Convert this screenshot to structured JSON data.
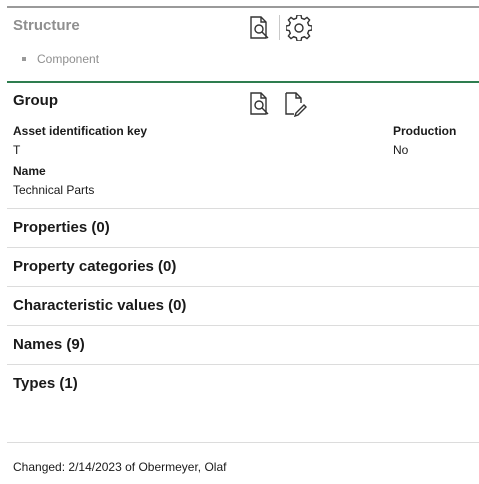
{
  "structure": {
    "title": "Structure",
    "items": [
      {
        "label": "Component"
      }
    ]
  },
  "group": {
    "title": "Group",
    "fields": {
      "asset_key_label": "Asset identification key",
      "asset_key_value": "T",
      "production_label": "Production",
      "production_value": "No",
      "name_label": "Name",
      "name_value": "Technical Parts"
    }
  },
  "sections": [
    {
      "label": "Properties (0)"
    },
    {
      "label": "Property categories (0)"
    },
    {
      "label": "Characteristic values (0)"
    },
    {
      "label": "Names (9)"
    },
    {
      "label": "Types (1)"
    }
  ],
  "footer": {
    "changed_label": "Changed:",
    "changed_value": "2/14/2023 of Obermeyer, Olaf"
  },
  "icons": {
    "structure_search": "document-search-icon",
    "structure_settings": "gear-icon",
    "group_search": "document-search-icon",
    "group_edit": "document-edit-icon"
  },
  "colors": {
    "accent_green": "#2e7d4f",
    "muted_gray": "#8f8f8f"
  }
}
